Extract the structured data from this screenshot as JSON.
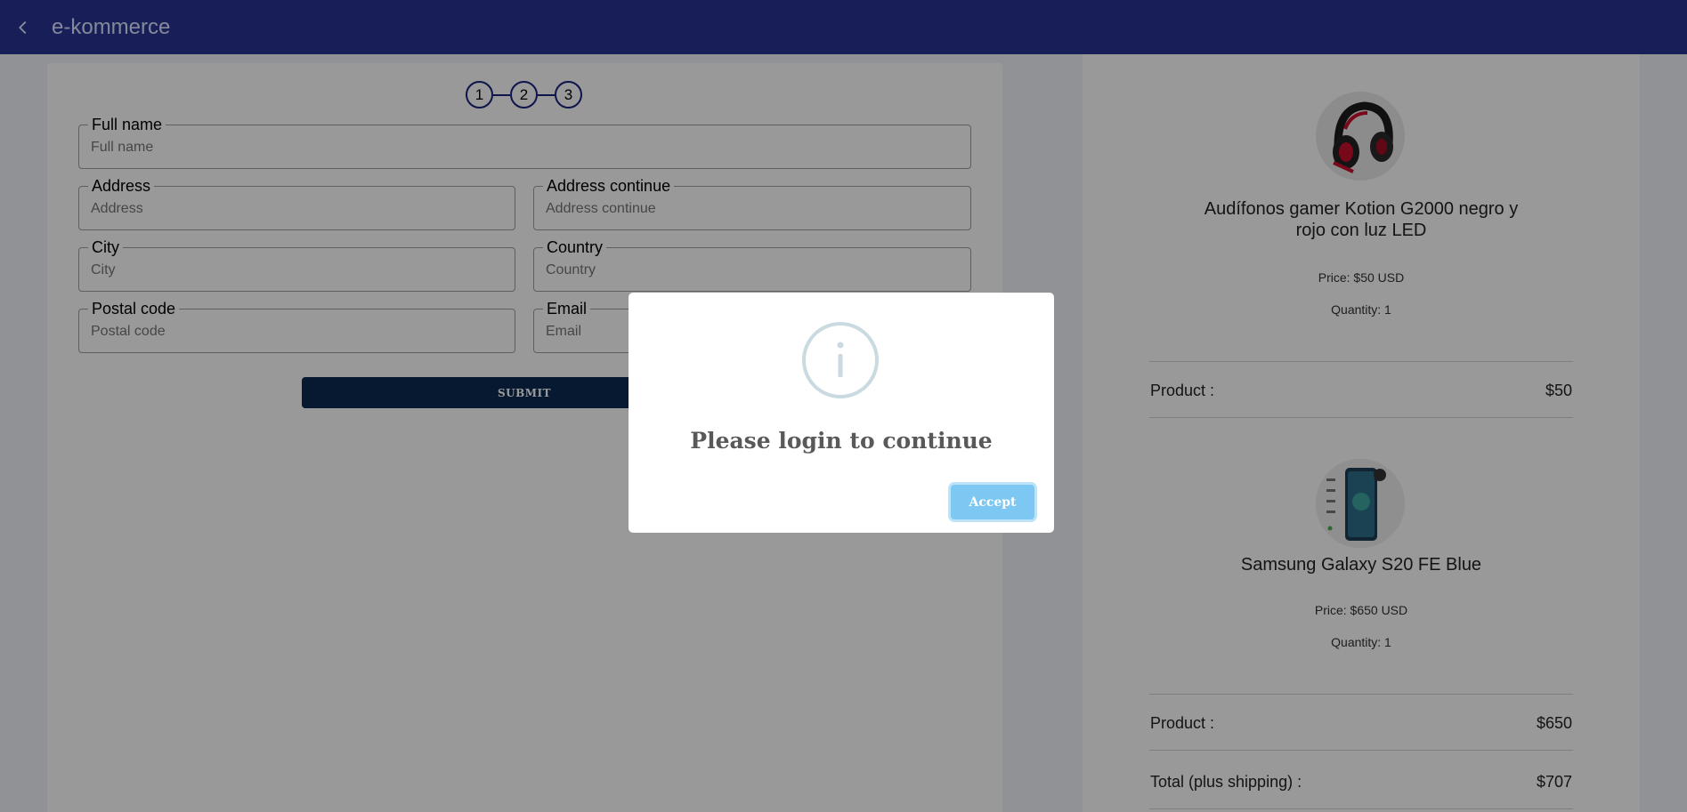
{
  "appbar": {
    "title": "e-kommerce"
  },
  "stepper": {
    "steps": [
      "1",
      "2",
      "3"
    ]
  },
  "form": {
    "full_name": {
      "label": "Full name",
      "placeholder": "Full name"
    },
    "address": {
      "label": "Address",
      "placeholder": "Address"
    },
    "address_continue": {
      "label": "Address continue",
      "placeholder": "Address continue"
    },
    "city": {
      "label": "City",
      "placeholder": "City"
    },
    "country": {
      "label": "Country",
      "placeholder": "Country"
    },
    "postal_code": {
      "label": "Postal code",
      "placeholder": "Postal code"
    },
    "email": {
      "label": "Email",
      "placeholder": "Email"
    },
    "submit_label": "SUBMIT"
  },
  "summary": {
    "products": [
      {
        "name": "Audífonos gamer Kotion G2000 negro y rojo con luz LED",
        "price": "Price: $50 USD",
        "quantity": "Quantity: 1",
        "product_label": "Product :",
        "product_total": "$50",
        "image_icon": "headphones-image"
      },
      {
        "name": "Samsung Galaxy S20 FE Blue",
        "price": "Price: $650 USD",
        "quantity": "Quantity: 1",
        "product_label": "Product :",
        "product_total": "$650",
        "image_icon": "smartphone-image"
      }
    ],
    "total_label": "Total (plus shipping) :",
    "total_value": "$707"
  },
  "modal": {
    "icon": "info-icon",
    "title": "Please login to continue",
    "accept_label": "Accept"
  },
  "colors": {
    "appbar": "#283593",
    "submit": "#0d2b52",
    "accept": "#7cc8f2",
    "info_ring": "#c9dae1"
  }
}
